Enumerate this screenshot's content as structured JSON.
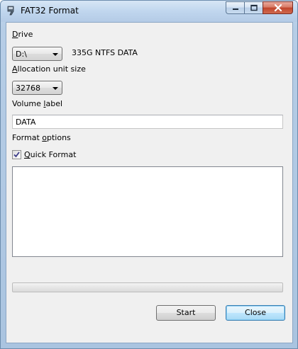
{
  "window": {
    "title": "FAT32 Format"
  },
  "drive": {
    "label_prefix": "",
    "label_underlined": "D",
    "label_rest": "rive",
    "selected": "D:\\",
    "info": "335G NTFS DATA"
  },
  "allocation": {
    "label_underlined": "A",
    "label_rest": "llocation unit size",
    "selected": "32768"
  },
  "volume": {
    "label_before": "Volume ",
    "label_underlined": "l",
    "label_after": "abel",
    "value": "DATA"
  },
  "format_options": {
    "label_before": "Format ",
    "label_underlined": "o",
    "label_after": "ptions",
    "quick_format_underlined": "Q",
    "quick_format_rest": "uick Format",
    "quick_format_checked": true
  },
  "progress": {
    "fraction": 0
  },
  "buttons": {
    "start": "Start",
    "close": "Close"
  },
  "icons": {
    "app": "format-app-icon",
    "minimize": "minimize-icon",
    "maximize": "maximize-icon",
    "close": "close-icon",
    "dropdown": "chevron-down-icon",
    "check": "checkmark-icon"
  }
}
